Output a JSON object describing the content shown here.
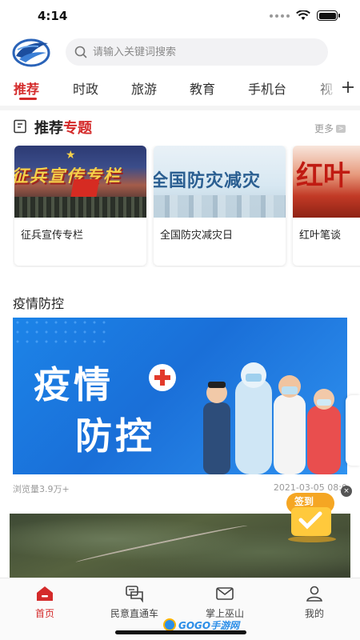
{
  "status_bar": {
    "time": "4:14"
  },
  "search": {
    "placeholder": "请输入关键词搜索"
  },
  "tabs": [
    {
      "label": "推荐",
      "active": true
    },
    {
      "label": "时政",
      "active": false
    },
    {
      "label": "旅游",
      "active": false
    },
    {
      "label": "教育",
      "active": false
    },
    {
      "label": "手机台",
      "active": false
    },
    {
      "label": "视",
      "active": false
    }
  ],
  "special_topics": {
    "title_prefix": "推荐",
    "title_highlight": "专题",
    "more_label": "更多",
    "cards": [
      {
        "title": "征兵宣传专栏",
        "image_text": "征兵宣传专栏"
      },
      {
        "title": "全国防灾减灾日",
        "image_text": "全国防灾减灾"
      },
      {
        "title": "红叶笔谈",
        "image_text": "红叶"
      }
    ]
  },
  "epidemic": {
    "section_title": "疫情防控",
    "banner_line1": "疫情",
    "banner_line2": "防控",
    "views": "浏览量3.9万+",
    "date": "2021-03-05 08:0"
  },
  "signin_widget": {
    "label": "签到",
    "close": "×"
  },
  "bottom_nav": [
    {
      "label": "首页",
      "icon": "home-icon",
      "active": true
    },
    {
      "label": "民意直通车",
      "icon": "chat-icon",
      "active": false
    },
    {
      "label": "掌上巫山",
      "icon": "mail-icon",
      "active": false
    },
    {
      "label": "我的",
      "icon": "user-icon",
      "active": false
    }
  ],
  "watermark": {
    "text": "GOGO手游网"
  },
  "colors": {
    "accent": "#d42a2a",
    "banner_blue": "#1a6fd8"
  }
}
